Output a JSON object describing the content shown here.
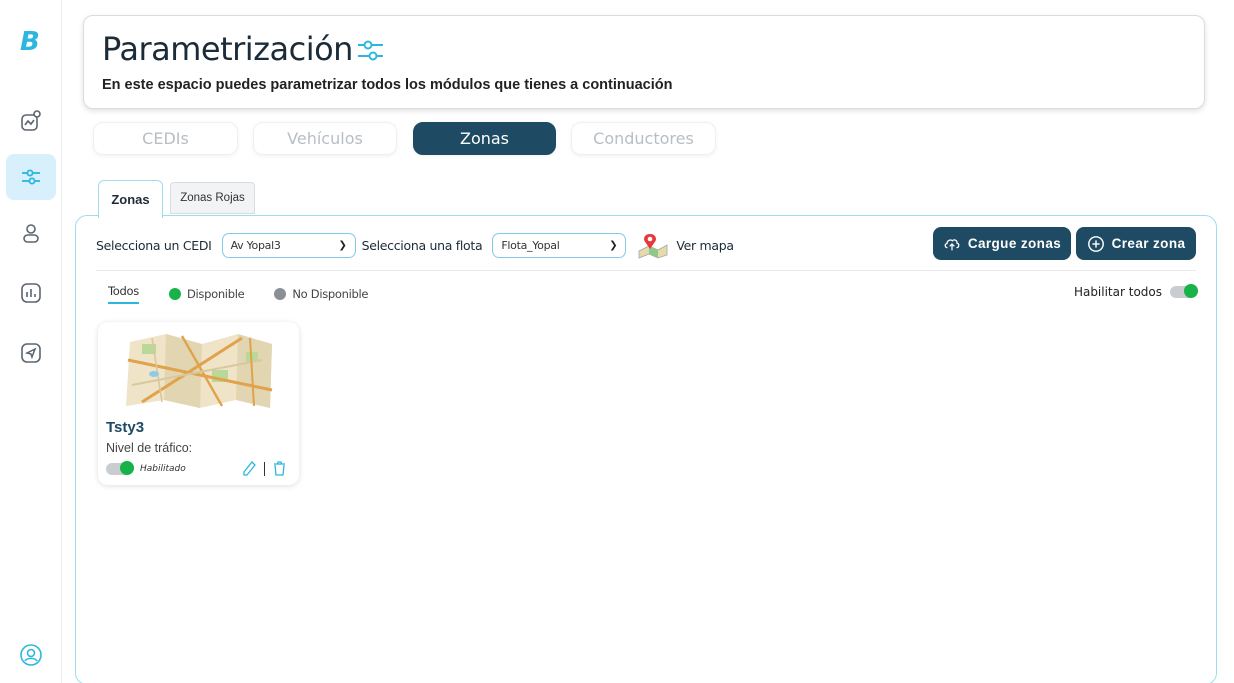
{
  "app": {
    "logo": "B"
  },
  "sidebar": {
    "items": [
      {
        "name": "analytics-icon",
        "active": false
      },
      {
        "name": "sliders-icon",
        "active": true
      },
      {
        "name": "user-icon",
        "active": false
      },
      {
        "name": "report-chart-icon",
        "active": false
      },
      {
        "name": "send-icon",
        "active": false
      }
    ],
    "footer_icon": "profile-icon"
  },
  "header": {
    "title": "Parametrización",
    "subtitle": "En este espacio puedes parametrizar todos los módulos que tienes a continuación"
  },
  "module_tabs": [
    {
      "label": "CEDIs",
      "active": false
    },
    {
      "label": "Vehículos",
      "active": false
    },
    {
      "label": "Zonas",
      "active": true
    },
    {
      "label": "Conductores",
      "active": false
    }
  ],
  "sub_tabs": [
    {
      "label": "Zonas",
      "active": true
    },
    {
      "label": "Zonas Rojas",
      "active": false
    }
  ],
  "filters": {
    "cedi_label": "Selecciona un CEDI",
    "cedi_value": "Av Yopal3",
    "fleet_label": "Selecciona una flota",
    "fleet_value": "Flota_Yopal",
    "map_link": "Ver mapa"
  },
  "actions": {
    "upload_label": "Cargue zonas",
    "create_label": "Crear zona"
  },
  "legend": {
    "all": "Todos",
    "available": "Disponible",
    "unavailable": "No Disponible",
    "enable_all": "Habilitar todos"
  },
  "colors": {
    "primary": "#1e4a63",
    "accent": "#2db7de",
    "available": "#17b24a",
    "unavailable": "#8a8f94"
  },
  "zones": [
    {
      "name": "Tsty3",
      "traffic_label": "Nivel de tráfico:",
      "status": "Habilitado",
      "enabled": true
    }
  ]
}
